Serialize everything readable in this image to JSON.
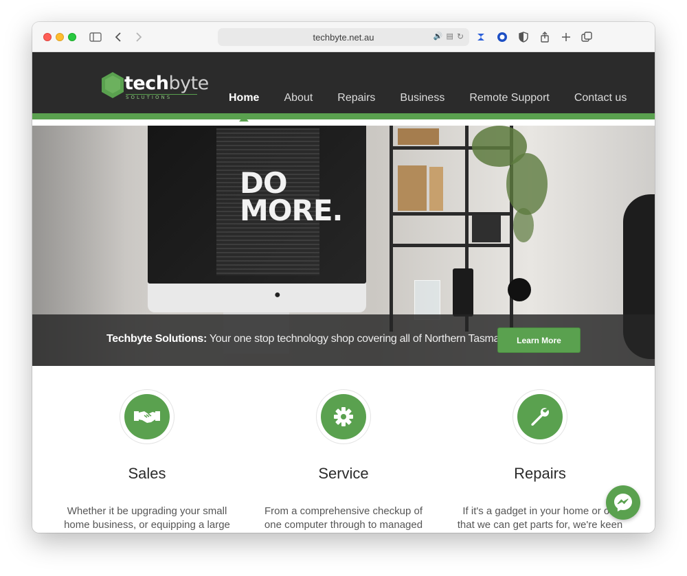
{
  "browser": {
    "url": "techbyte.net.au"
  },
  "site": {
    "logo_word_bold": "tech",
    "logo_word_light": "byte",
    "logo_sub": "SOLUTIONS",
    "nav": [
      {
        "label": "Home",
        "active": true
      },
      {
        "label": "About",
        "active": false
      },
      {
        "label": "Repairs",
        "active": false
      },
      {
        "label": "Business",
        "active": false
      },
      {
        "label": "Remote Support",
        "active": false
      },
      {
        "label": "Contact us",
        "active": false
      }
    ],
    "accent_color": "#5aa14f"
  },
  "hero": {
    "screen_line1": "DO",
    "screen_line2": "MORE.",
    "caption_bold": "Techbyte Solutions:",
    "caption_rest": " Your one stop technology shop covering all of Northern Tasmania",
    "button_label": "Learn More"
  },
  "features": [
    {
      "icon": "handshake-icon",
      "title": "Sales",
      "text_line1": "Whether it be upgrading your small",
      "text_line2": "home business, or equipping a large"
    },
    {
      "icon": "gear-icon",
      "title": "Service",
      "text_line1": "From a comprehensive checkup of",
      "text_line2": "one computer through to managed"
    },
    {
      "icon": "wrench-icon",
      "title": "Repairs",
      "text_line1": "If it's a gadget in your home or offi",
      "text_line2": "that we can get parts for, we're keen"
    }
  ]
}
